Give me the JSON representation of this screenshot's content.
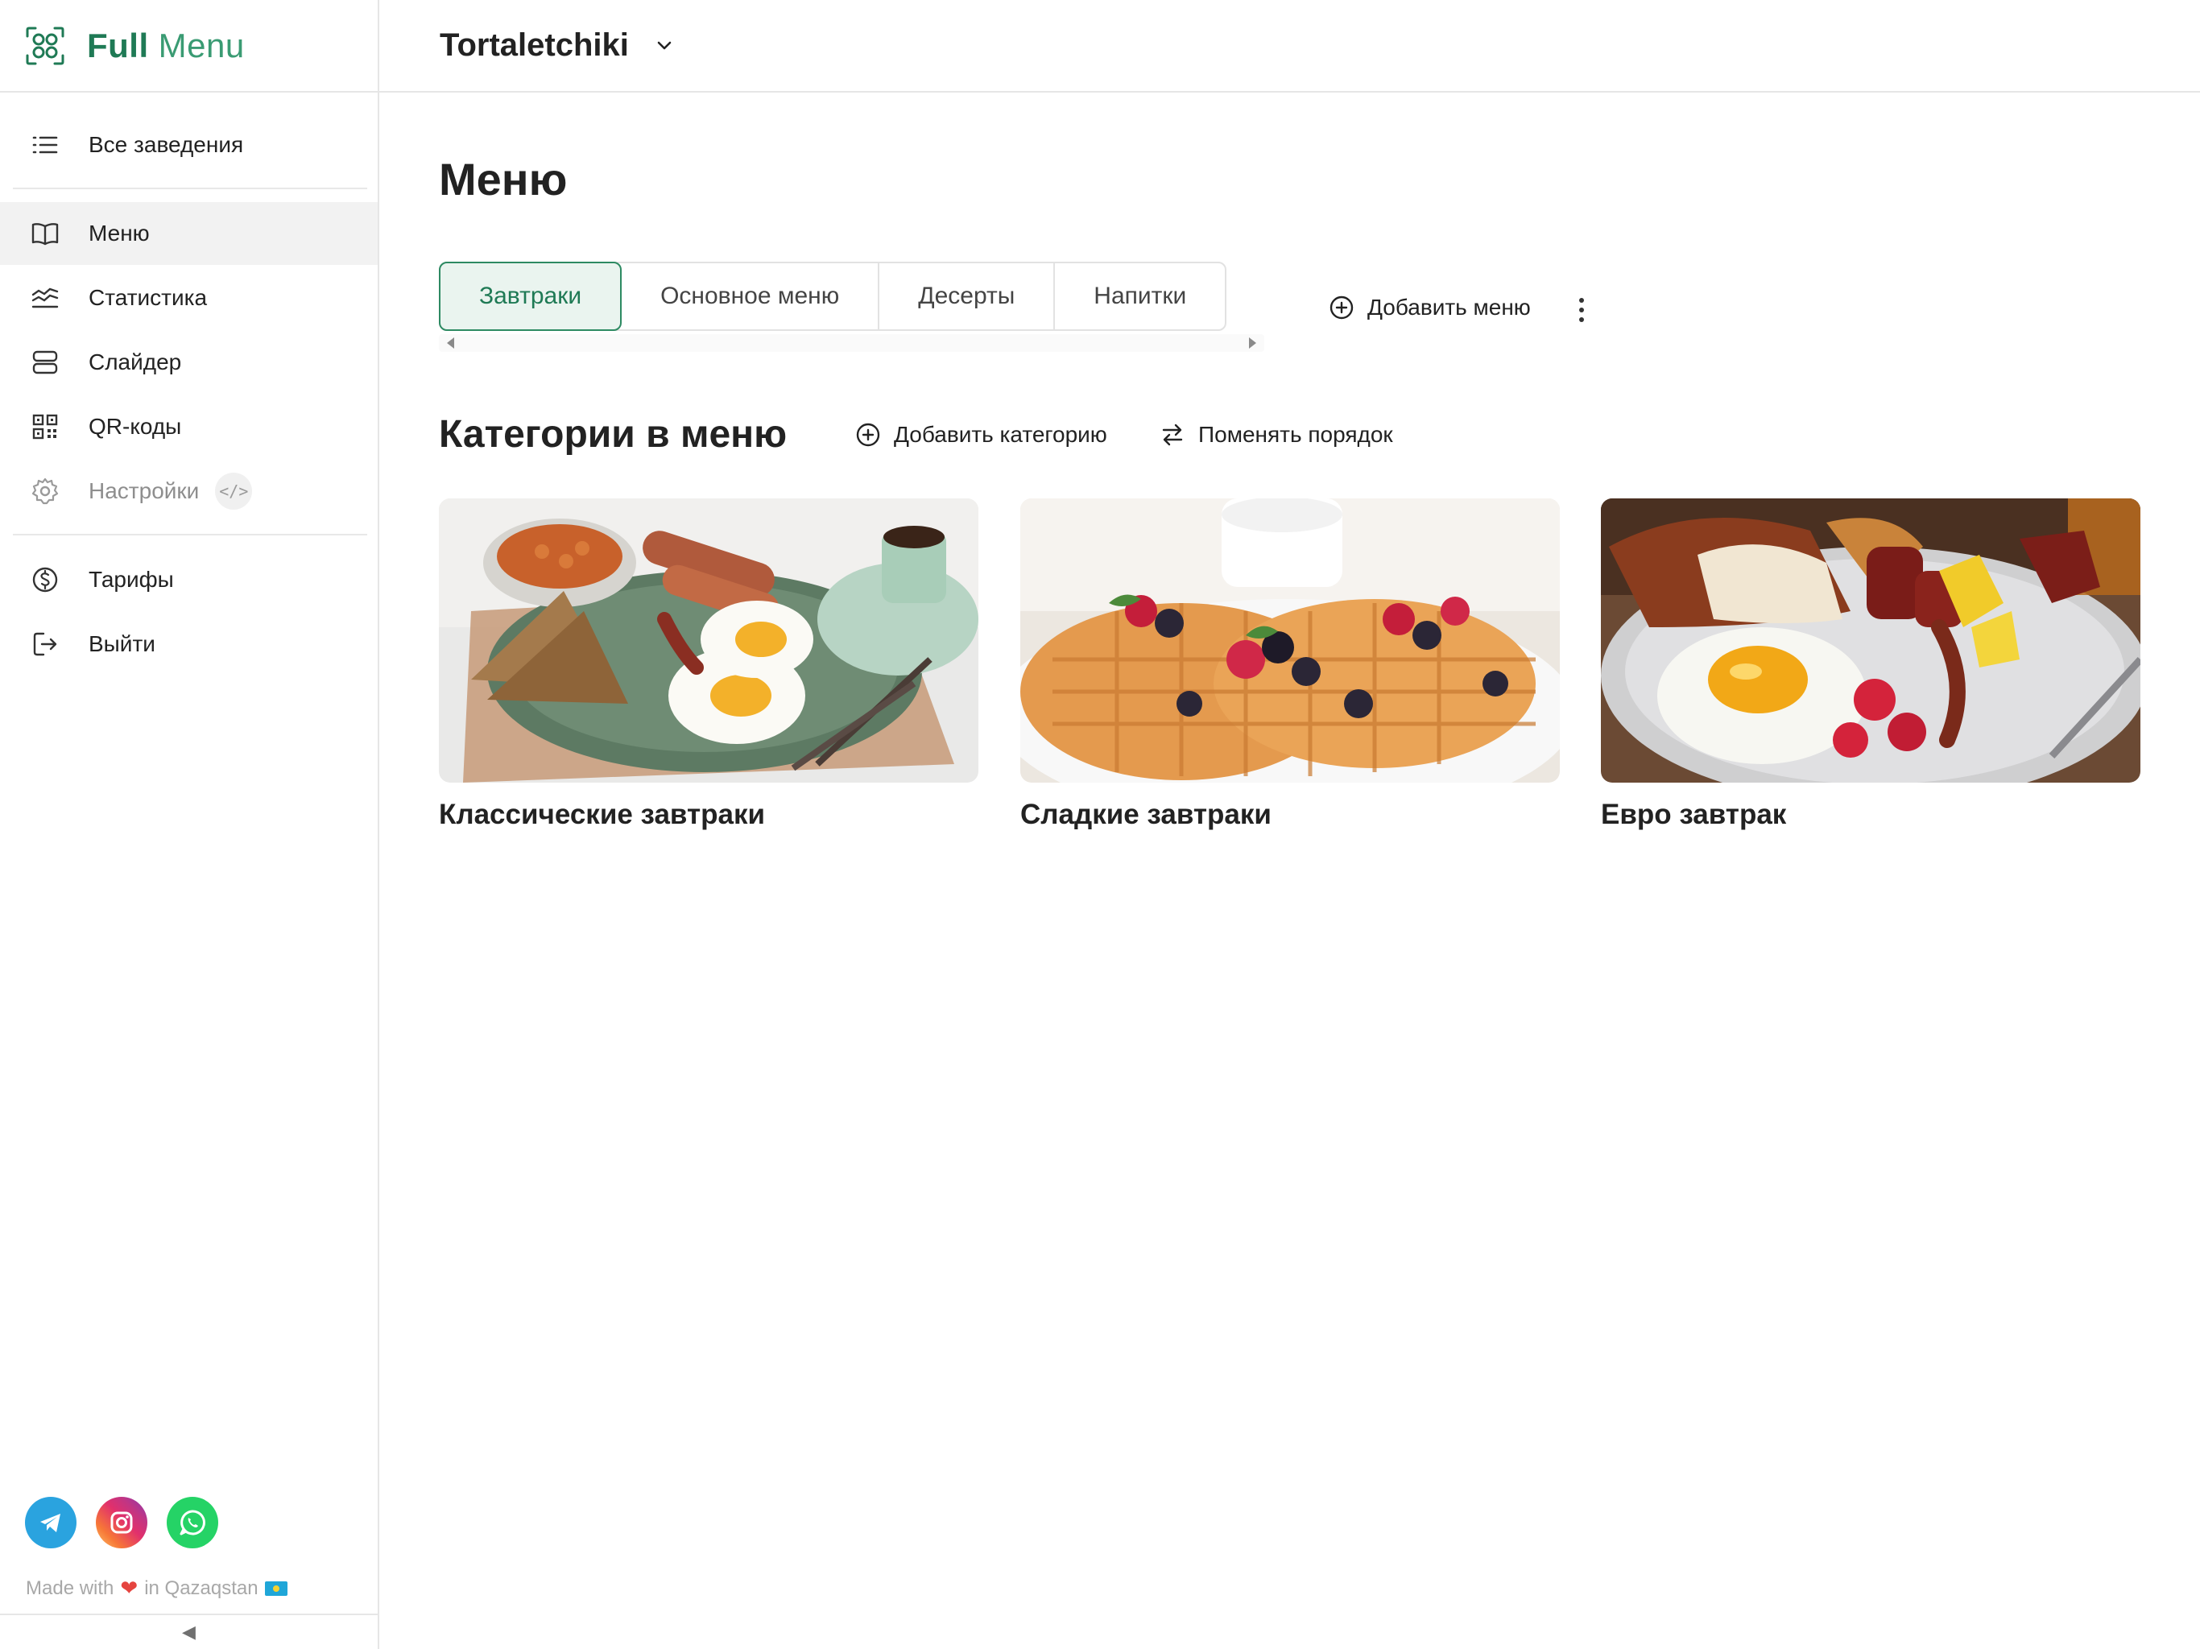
{
  "brand": {
    "name_primary": "Full",
    "name_secondary": "Menu"
  },
  "sidebar": {
    "all_venues": "Все заведения",
    "items": [
      {
        "label": "Меню",
        "active": true
      },
      {
        "label": "Статистика"
      },
      {
        "label": "Слайдер"
      },
      {
        "label": "QR-коды"
      },
      {
        "label": "Настройки",
        "badge": "</>"
      }
    ],
    "bottom_items": [
      {
        "label": "Тарифы"
      },
      {
        "label": "Выйти"
      }
    ],
    "socials": [
      "telegram-icon",
      "instagram-icon",
      "whatsapp-icon"
    ],
    "footer": {
      "made": "Made with",
      "in": "in Qazaqstan"
    },
    "collapse_glyph": "◀"
  },
  "header": {
    "venue": "Tortaletchiki"
  },
  "main": {
    "title": "Меню",
    "tabs": [
      {
        "label": "Завтраки",
        "active": true
      },
      {
        "label": "Основное меню"
      },
      {
        "label": "Десерты"
      },
      {
        "label": "Напитки"
      }
    ],
    "add_menu": "Добавить меню",
    "categories_title": "Категории в меню",
    "add_category": "Добавить категорию",
    "reorder": "Поменять порядок",
    "categories": [
      {
        "title": "Классические завтраки"
      },
      {
        "title": "Сладкие завтраки"
      },
      {
        "title": "Евро завтрак"
      }
    ]
  },
  "colors": {
    "brand_green": "#1f7a55",
    "active_tab_bg": "#eaf4ef",
    "active_nav_bg": "#f2f2f2"
  }
}
